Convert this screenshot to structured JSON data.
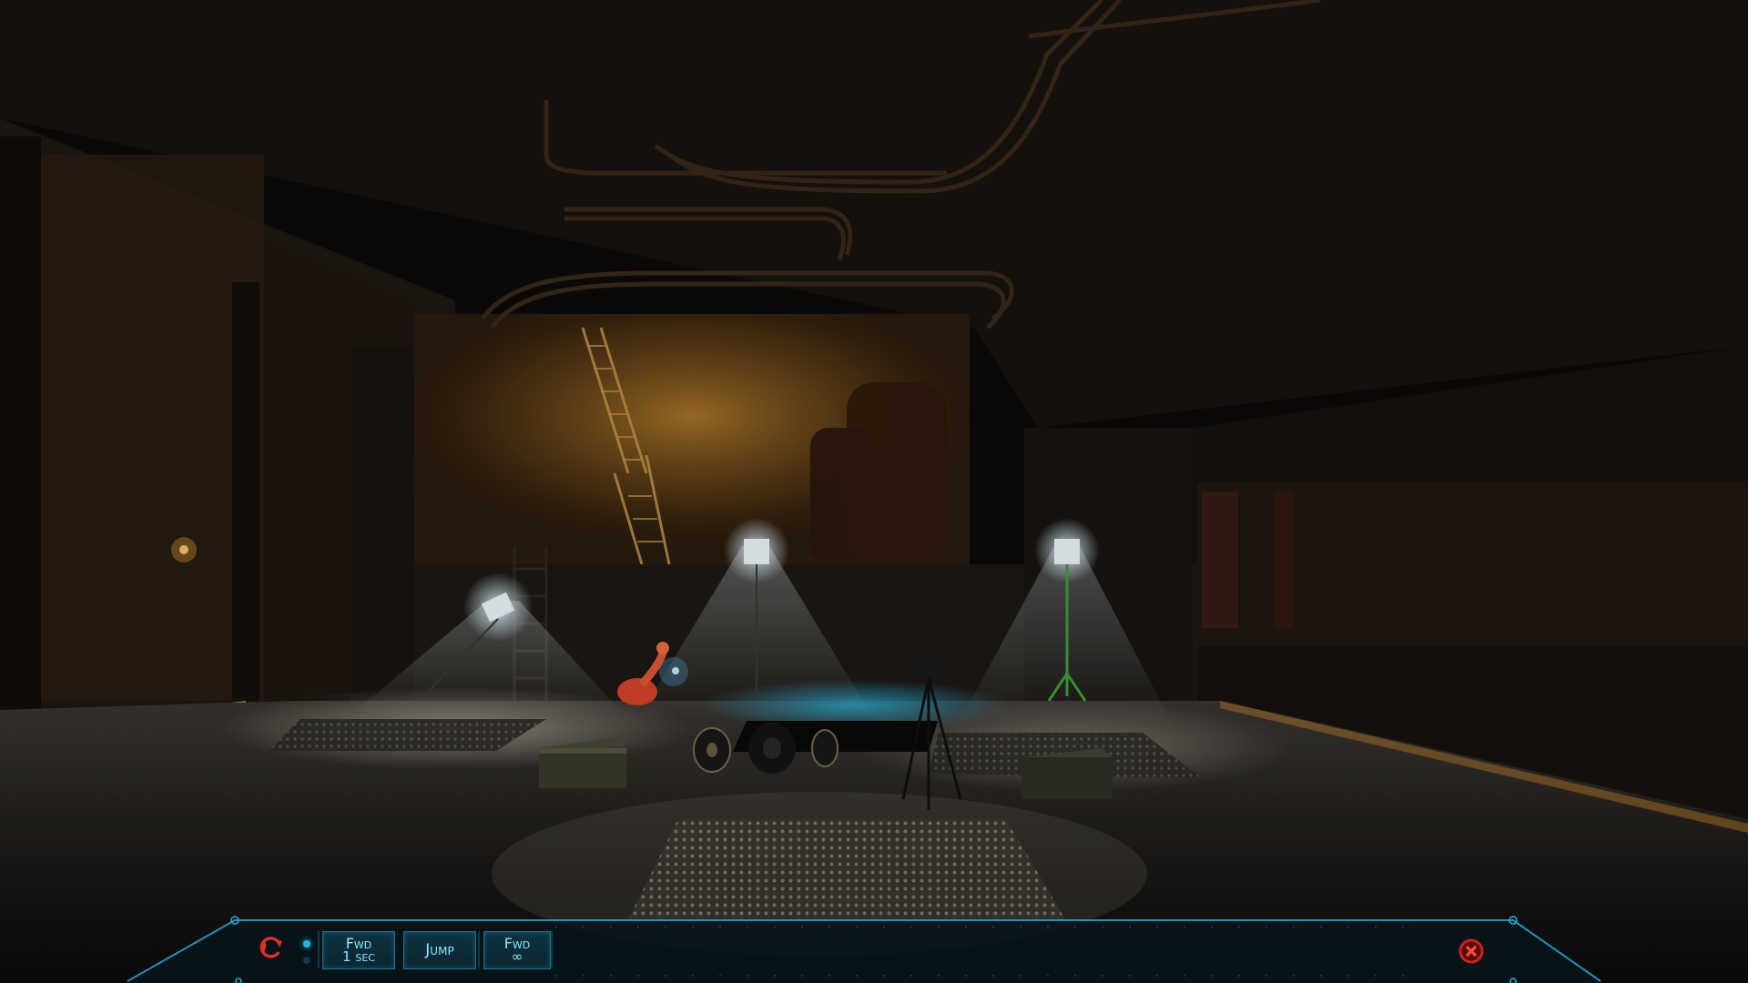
{
  "hud": {
    "buttons": {
      "fwd_1sec": {
        "line1": "Fwd",
        "line2": "1 sec"
      },
      "jump": {
        "label": "Jump"
      },
      "fwd_inf": {
        "line1": "Fwd",
        "line2": "∞"
      }
    },
    "icons": {
      "restart": "refresh-icon",
      "close": "close-icon",
      "indicator": "status-dot-icon"
    },
    "colors": {
      "accent": "#1fb6e0",
      "button_text": "#8fe6ff",
      "close_red": "#d11f1f",
      "restart_red": "#e0302a"
    }
  },
  "scene": {
    "description_icons": [
      "floodlight-icon",
      "floodlight-icon",
      "floodlight-icon",
      "tripod-icon",
      "cable-reel-icon",
      "crate-icon",
      "robot-drone-icon",
      "ladder-icon"
    ]
  }
}
